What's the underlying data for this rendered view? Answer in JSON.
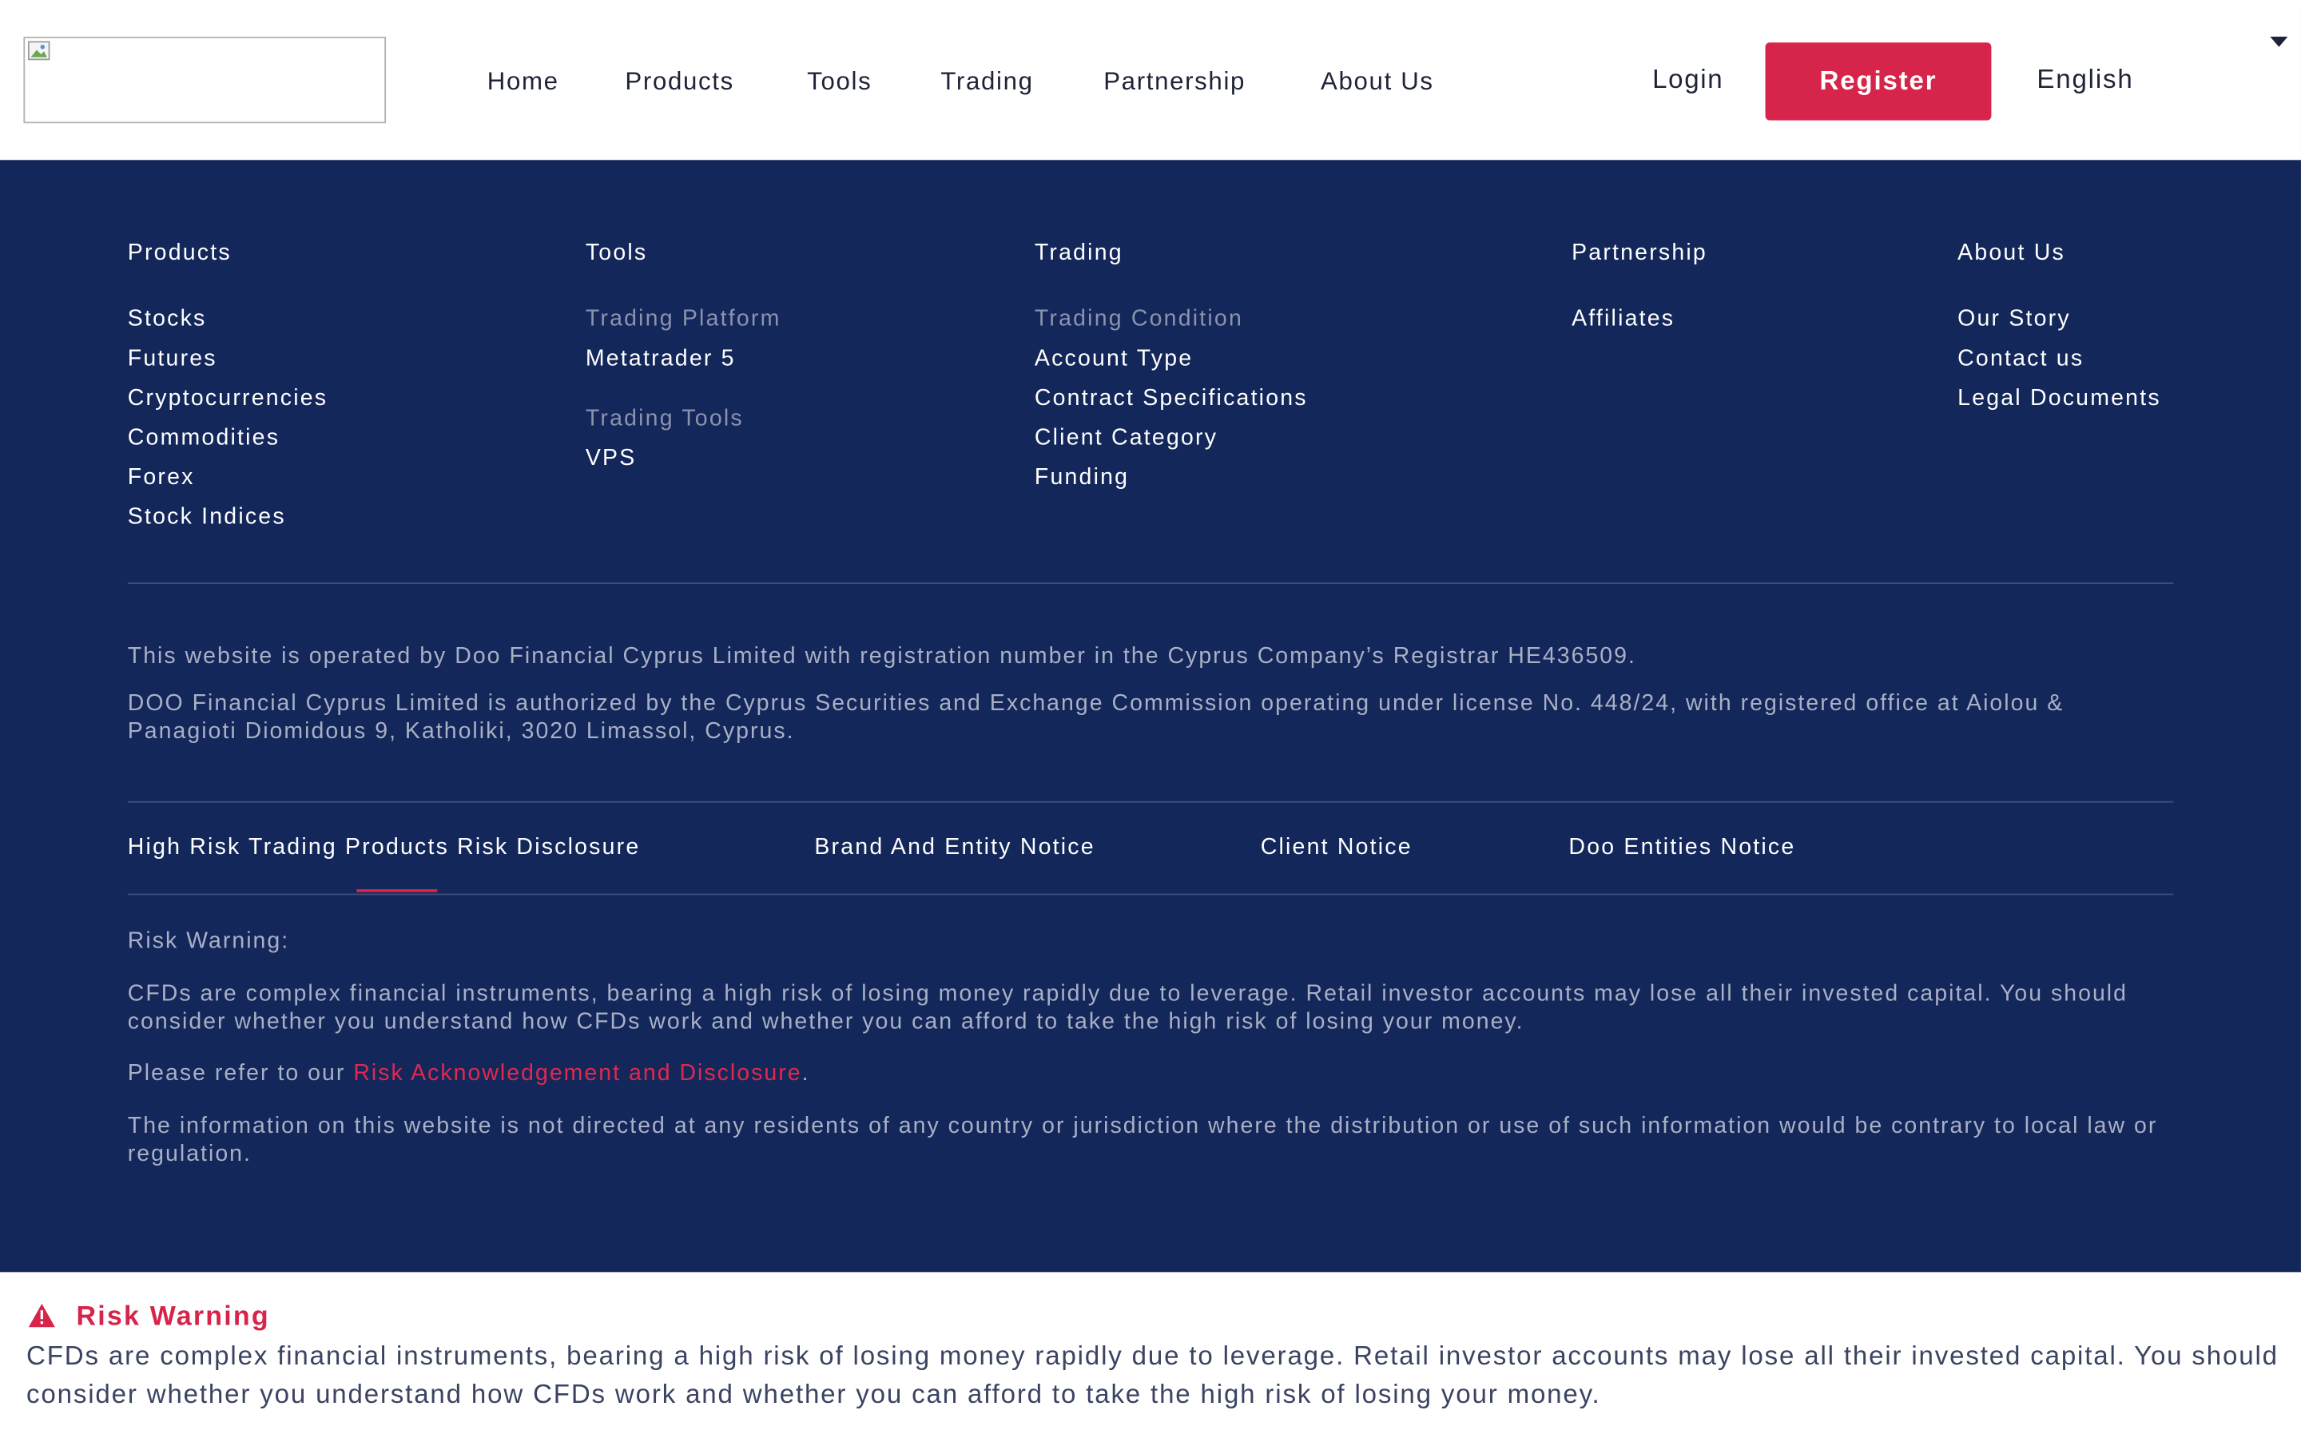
{
  "colors": {
    "footer_bg": "#14275a",
    "accent_red": "#d6244a",
    "text_dark": "#1e2337",
    "muted": "#8b93ad"
  },
  "header": {
    "logo_icon": "broken-image-icon",
    "nav": [
      "Home",
      "Products",
      "Tools",
      "Trading",
      "Partnership",
      "About Us"
    ],
    "login": "Login",
    "register": "Register",
    "language": "English"
  },
  "footer": {
    "products": {
      "title": "Products",
      "links": [
        "Stocks",
        "Futures",
        "Cryptocurrencies",
        "Commodities",
        "Forex",
        "Stock Indices"
      ]
    },
    "tools": {
      "title": "Tools",
      "group1_label": "Trading Platform",
      "group1_links": [
        "Metatrader 5"
      ],
      "group2_label": "Trading Tools",
      "group2_links": [
        "VPS"
      ]
    },
    "trading": {
      "title": "Trading",
      "group_label": "Trading Condition",
      "links": [
        "Account Type",
        "Contract Specifications",
        "Client Category",
        "Funding"
      ]
    },
    "partnership": {
      "title": "Partnership",
      "links": [
        "Affiliates"
      ]
    },
    "about": {
      "title": "About Us",
      "links": [
        "Our Story",
        "Contact us",
        "Legal Documents"
      ]
    },
    "legal": {
      "operated": "This website is operated by Doo Financial Cyprus Limited with registration number in the Cyprus Company’s Registrar HE436509.",
      "authorized": "DOO Financial Cyprus Limited is authorized by the Cyprus Securities and Exchange Commission operating under license No. 448/24, with registered office at Aiolou & Panagioti Diomidous 9, Katholiki, 3020 Limassol, Cyprus."
    },
    "tabs": [
      "High Risk Trading Products Risk Disclosure",
      "Brand And Entity Notice",
      "Client Notice",
      "Doo Entities Notice"
    ],
    "risk": {
      "heading": "Risk Warning:",
      "body": "CFDs are complex financial instruments, bearing a high risk of losing money rapidly due to leverage. Retail investor accounts may lose all their invested capital. You should consider whether you understand how CFDs work and whether you can afford to take the high risk of losing your money.",
      "refer_prefix": "Please refer to our ",
      "refer_link": "Risk Acknowledgement and Disclosure",
      "refer_suffix": ".",
      "jurisdiction": "The information on this website is not directed at any residents of any country or jurisdiction where the distribution or use of such information would be contrary to local law or regulation."
    }
  },
  "banner": {
    "icon": "warning-icon",
    "title": "Risk Warning",
    "text": "CFDs are complex financial instruments, bearing a high risk of losing money rapidly due to leverage. Retail investor accounts may lose all their invested capital. You should consider whether you understand how CFDs work and whether you can afford to take the high risk of losing your money."
  }
}
